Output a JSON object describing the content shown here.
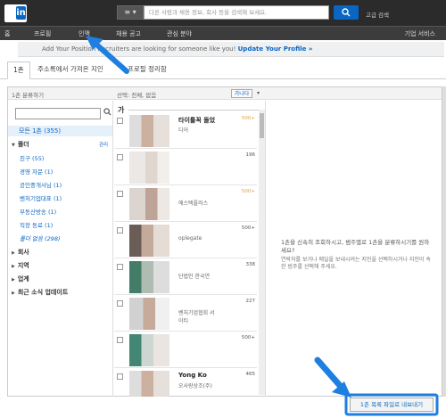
{
  "header": {
    "logo_text": "Linked",
    "logo_badge": "in",
    "menu_icon": "≡ ▾",
    "search_placeholder": "다른 사람과 채용 정보, 회사 등을 검색해 보세요.",
    "search_icon": "search-icon",
    "advanced": "고급 검색"
  },
  "nav": {
    "items": [
      "홈",
      "프로필",
      "인맥",
      "채용 공고",
      "관심 분야"
    ],
    "right": "기업 서비스"
  },
  "banner": {
    "text": "Add Your Position  Recruiters are looking for someone like you! ",
    "link": "Update Your Profile »"
  },
  "tabs": [
    "1촌",
    "주소록에서 가져온 지인",
    "프로필 정리함"
  ],
  "left": {
    "header": "1촌 분류하기",
    "all": "모든 1촌 (355)",
    "folders_label": "폴더",
    "manage": "관리",
    "folder_items": [
      "친구 (55)",
      "경영 자문 (1)",
      "공인중개사님 (1)",
      "벤처기업대표 (1)",
      "부동산방송 (1)",
      "직장 동료 (1)",
      "폴더 없음 (298)"
    ],
    "sections": [
      "회사",
      "지역",
      "업계",
      "최근 소식 업데이트"
    ]
  },
  "middle": {
    "header": "선택: 전체, 없음",
    "sort": "가나다",
    "sort_caret": "▾",
    "alpha": "가",
    "rows": [
      {
        "name": "타이틀꼭 돌었",
        "sub": "디어",
        "num": "500+",
        "num_orange": true
      },
      {
        "name": "",
        "sub": "",
        "num": "196",
        "num_orange": false
      },
      {
        "name": "",
        "sub": "에스텍플러스",
        "num": "500+",
        "num_orange": true
      },
      {
        "name": "",
        "sub": "oplegate",
        "num": "500+",
        "num_orange": false
      },
      {
        "name": "",
        "sub": "단법인 한국연",
        "num": "338",
        "num_orange": false
      },
      {
        "name": "",
        "sub": "벤처기업협회 서\n이티",
        "num": "227",
        "num_orange": false
      },
      {
        "name": "",
        "sub": "",
        "num": "500+",
        "num_orange": false
      },
      {
        "name": "Yong Ko",
        "sub": "오사랑상조(주)",
        "num": "465",
        "num_orange": false
      }
    ]
  },
  "right": {
    "hint": "1촌을 신속히 조회하시고, 범주별로 1촌을 분류하시기를 원하세요?",
    "hint2": "연락처를 보거나 메일을 보내시려는 지인을 선택하시거나 지인이 속한 범주를 선택해 주세요."
  },
  "export": "1촌 목록 파일로 내보내기",
  "colors": {
    "brand": "#0a66c2",
    "annotation": "#1e7fe0"
  }
}
